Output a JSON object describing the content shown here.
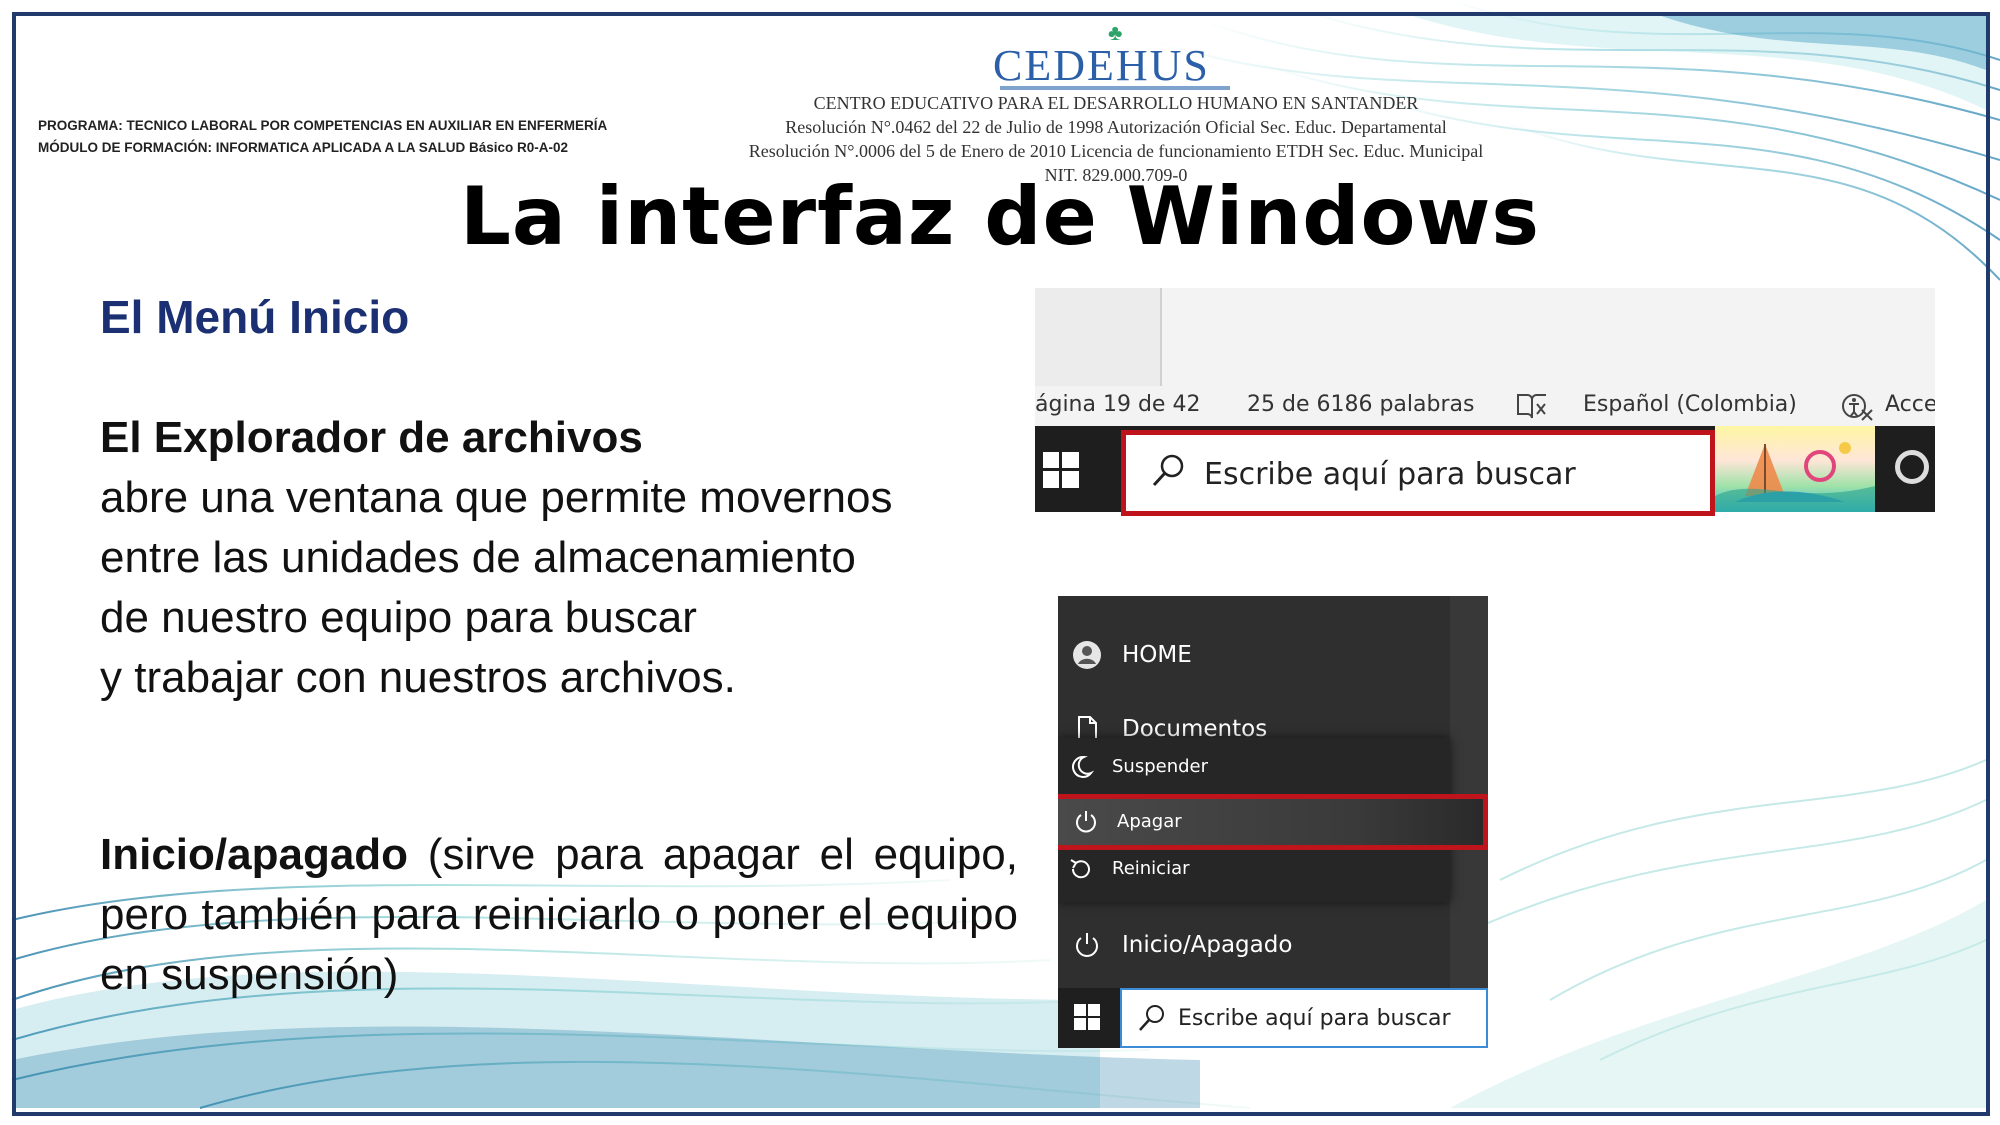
{
  "header": {
    "logo_text": "CEDEHUS",
    "institution_lines": [
      "CENTRO EDUCATIVO PARA EL DESARROLLO HUMANO EN SANTANDER",
      "Resolución  N°.0462 del 22 de Julio de 1998  Autorización Oficial Sec. Educ. Departamental",
      "Resolución N°.0006 del 5 de Enero de 2010 Licencia de funcionamiento ETDH Sec. Educ. Municipal",
      "NIT. 829.000.709-0"
    ],
    "program_line": "PROGRAMA: TECNICO LABORAL POR COMPETENCIAS EN AUXILIAR EN ENFERMERÍA",
    "module_line": "MÓDULO DE FORMACIÓN: INFORMATICA APLICADA A LA SALUD Básico R0-A-02"
  },
  "title": "La interfaz de Windows",
  "subtitle": "El Menú Inicio",
  "section1": {
    "heading": "El Explorador de archivos",
    "lines": [
      "abre una ventana que permite movernos",
      "entre las unidades de almacenamiento",
      "de nuestro equipo para buscar",
      "y trabajar con nuestros archivos."
    ]
  },
  "section2": {
    "heading": "Inicio/apagado",
    "text": "(sirve para apagar el equipo, pero también para reiniciarlo o poner el equipo en suspensión)"
  },
  "screenshot_statusbar": {
    "page_info": "ágina 19 de 42",
    "word_count": "25 de 6186 palabras",
    "language": "Español (Colombia)",
    "accessibility": "Acce",
    "search_placeholder": "Escribe aquí para buscar"
  },
  "screenshot_startmenu": {
    "user": "HOME",
    "documents": "Documentos",
    "suspend": "Suspender",
    "shutdown": "Apagar",
    "restart": "Reiniciar",
    "power": "Inicio/Apagado",
    "search_placeholder": "Escribe aquí para buscar"
  },
  "colors": {
    "border": "#1f3a6b",
    "subtitle": "#1b2f73",
    "highlight": "#c0141c",
    "logo": "#2b5fa8"
  }
}
